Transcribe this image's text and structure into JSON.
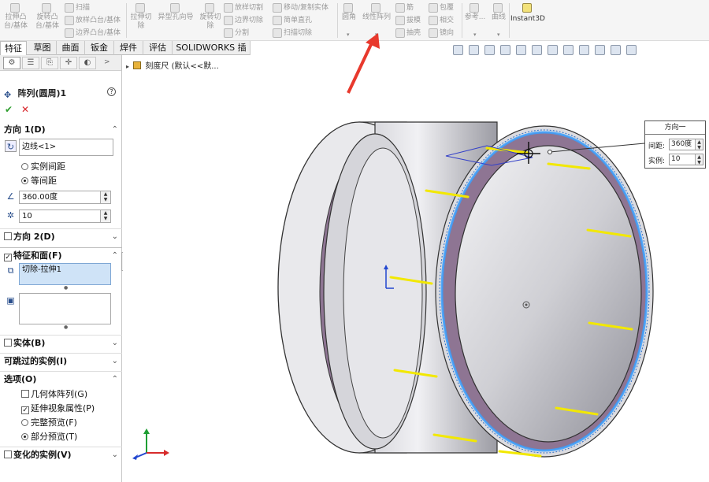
{
  "ribbon": {
    "extrude_boss": "拉伸凸台/基体",
    "revolve_boss": "旋转凸台/基体",
    "sweep": "扫描",
    "loft": "放样凸台/基体",
    "boundary_boss": "边界凸台/基体",
    "extrude_cut": "拉伸切除",
    "hole_wizard": "异型孔向导",
    "revolve_cut": "旋转切除",
    "loft_cut": "放样切割",
    "boundary_cut": "边界切除",
    "split": "分割",
    "move_copy": "移动/复制实体",
    "simple_hole": "简单直孔",
    "swept_cut": "扫描切除",
    "fillet": "圆角",
    "linear_pattern": "线性阵列",
    "rib": "筋",
    "draft": "拔模",
    "shell": "抽壳",
    "wrap": "包覆",
    "intersect": "相交",
    "mirror": "镜向",
    "reference": "参考...",
    "curves": "曲线",
    "instant3d": "Instant3D"
  },
  "tabs": [
    "特征",
    "草图",
    "曲面",
    "钣金",
    "焊件",
    "评估",
    "SOLIDWORKS 插件"
  ],
  "panel": {
    "title": "阵列(圆周)1",
    "help": "?",
    "ok": "✔",
    "cancel": "✕",
    "dir1": {
      "header": "方向 1(D)",
      "edge_value": "边线<1>",
      "opt_spacing": "实例间距",
      "opt_equal": "等间距",
      "angle": "360.00度",
      "count": "10"
    },
    "dir2": "方向 2(D)",
    "features": {
      "header": "特征和面(F)",
      "item": "切除-拉伸1"
    },
    "bodies": "实体(B)",
    "skip": "可跳过的实例(I)",
    "options": {
      "header": "选项(O)",
      "geom": "几何体阵列(G)",
      "propagate": "延伸视象属性(P)",
      "full": "完整预览(F)",
      "partial": "部分预览(T)"
    },
    "vary": "变化的实例(V)"
  },
  "tree": {
    "item": "刻度尺 (默认<<默..."
  },
  "callout": {
    "title": "方向一",
    "spacing_label": "间距:",
    "spacing_value": "360度",
    "count_label": "实例:",
    "count_value": "10"
  },
  "colors": {
    "accent_arrow": "#e8392d",
    "ring_face": "#8e7593",
    "slot": "#f2e800",
    "preview": "#3aa0ff"
  }
}
